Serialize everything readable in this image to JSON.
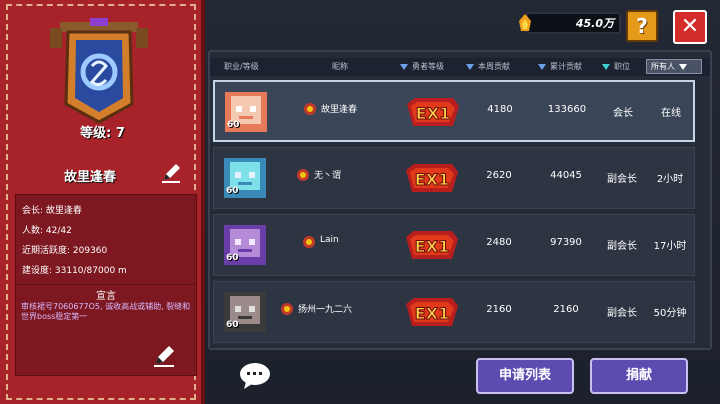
{
  "guild": {
    "level_label": "等级: 7",
    "name": "故里逢春",
    "info": {
      "leader": "会长: 故里逢春",
      "members": "人数: 42/42",
      "activity": "近期活跃度: 209360",
      "construction": "建设度: 33110/87000 m"
    },
    "notice_title": "宣言",
    "notice_text": "审核裙号7060677O5, 诚收高战或辅助, 裂缝和世界boss稳定第一"
  },
  "topbar": {
    "gold_value": "45.0万",
    "help_label": "?",
    "close_label": "✕"
  },
  "table": {
    "headers": {
      "job_level": "职业/等级",
      "nickname": "昵称",
      "hero_level": "勇者等级",
      "week_contrib": "本周贡献",
      "total_contrib": "累计贡献",
      "position": "职位"
    },
    "filter_label": "所有人",
    "rows": [
      {
        "avatar_level": "60",
        "nickname": "故里逢春",
        "hero_level": "EX1",
        "week": "4180",
        "total": "133660",
        "position": "会长",
        "status": "在线",
        "selected": true
      },
      {
        "avatar_level": "60",
        "nickname": "无丶谓",
        "hero_level": "EX1",
        "week": "2620",
        "total": "44045",
        "position": "副会长",
        "status": "2小时",
        "selected": false
      },
      {
        "avatar_level": "60",
        "nickname": "Lain",
        "hero_level": "EX1",
        "week": "2480",
        "total": "97390",
        "position": "副会长",
        "status": "17小时",
        "selected": false
      },
      {
        "avatar_level": "60",
        "nickname": "扬州一九二六",
        "hero_level": "EX1",
        "week": "2160",
        "total": "2160",
        "position": "副会长",
        "status": "50分钟",
        "selected": false
      }
    ]
  },
  "bottom": {
    "apply_label": "申请列表",
    "donate_label": "捐献"
  },
  "colors": {
    "banner_red": "#a8222a",
    "button_purple": "#5d4bb0",
    "close_red": "#d42b2b",
    "help_orange": "#e59a1c"
  }
}
